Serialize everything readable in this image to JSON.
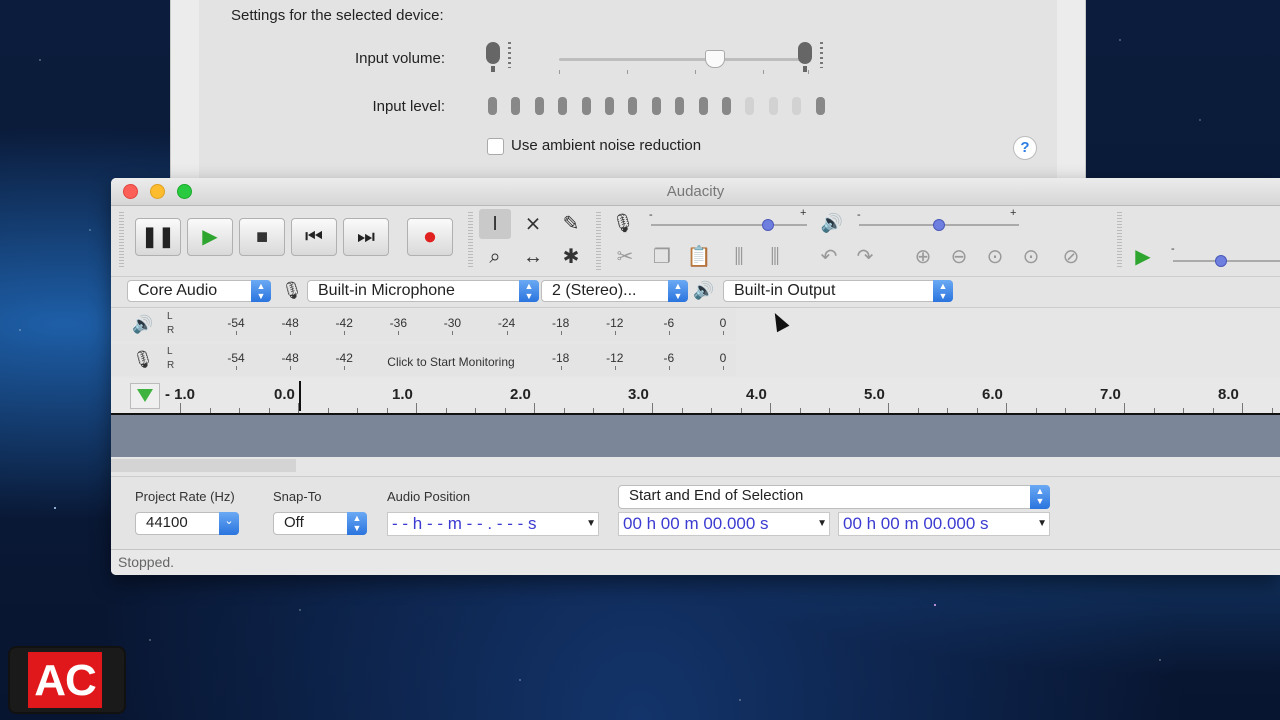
{
  "prefs": {
    "settings_heading": "Settings for the selected device:",
    "input_volume_label": "Input volume:",
    "input_volume_level": 0.62,
    "input_level_label": "Input level:",
    "input_level_active_segments": 11,
    "input_level_total_segments": 15,
    "ambient_noise_label": "Use ambient noise reduction",
    "ambient_noise_checked": false,
    "help_symbol": "?"
  },
  "audacity": {
    "title": "Audacity",
    "transport": [
      "pause-icon",
      "play-icon",
      "stop-icon",
      "skip-start-icon",
      "skip-end-icon",
      "record-icon"
    ],
    "plus_sign": "+",
    "minus_sign": "-",
    "recording_volume": 0.75,
    "playback_volume": 0.5,
    "play_at_speed": 0.4,
    "device_toolbar": {
      "host": "Core Audio",
      "input_device": "Built-in Microphone",
      "channels": "2 (Stereo)...",
      "output_device": "Built-in Output"
    },
    "meters": {
      "channel_left": "L",
      "channel_right": "R",
      "scale": [
        "-54",
        "-48",
        "-42",
        "-36",
        "-30",
        "-24",
        "-18",
        "-12",
        "-6",
        "0"
      ],
      "record_scale": [
        "-54",
        "-48",
        "-42",
        "-18",
        "-12",
        "-6",
        "0"
      ],
      "monitor_hint": "Click to Start Monitoring"
    },
    "ruler": [
      "- 1.0",
      "0.0",
      "1.0",
      "2.0",
      "3.0",
      "4.0",
      "5.0",
      "6.0",
      "7.0",
      "8.0"
    ],
    "selection_toolbar": {
      "project_rate_label": "Project Rate (Hz)",
      "project_rate_value": "44100",
      "snap_to_label": "Snap-To",
      "snap_to_value": "Off",
      "audio_position_label": "Audio Position",
      "audio_position_value": "- - h - - m - - . - - -  s",
      "selection_mode": "Start and End of Selection",
      "start_time": "00 h 00 m 00.000 s",
      "end_time": "00 h 00 m 00.000 s"
    },
    "status": "Stopped."
  },
  "logo_text": "AC",
  "colors": {
    "record_red": "#e0211f",
    "play_green": "#2ea52e",
    "accent_blue": "#2a74de",
    "time_text": "#3b3bd2"
  }
}
